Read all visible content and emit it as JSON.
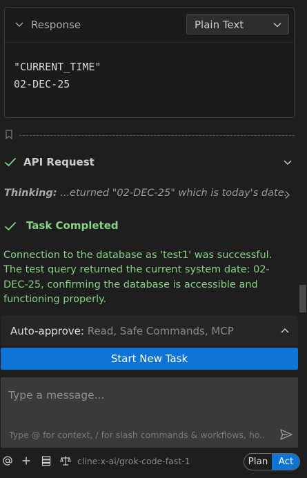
{
  "response": {
    "title": "Response",
    "language": "Plain Text",
    "lines": [
      "\"CURRENT_TIME\"",
      "02-DEC-25"
    ]
  },
  "api_request": {
    "label": "API Request",
    "status": "completed"
  },
  "thinking": {
    "label": "Thinking:",
    "text": " ...eturned \"02-DEC-25\" which is today's date."
  },
  "task": {
    "label": "Task Completed",
    "result": "Connection to the database as 'test1' was successful. The test query returned the current system date: 02-DEC-25, confirming the database is accessible and functioning properly."
  },
  "auto_approve": {
    "label": "Auto-approve:",
    "values": " Read, Safe Commands, MCP"
  },
  "start_button": "Start New Task",
  "input": {
    "placeholder": "Type a message...",
    "hint": "Type @ for context, / for slash commands & workflows, ho..."
  },
  "toolbar": {
    "icons": [
      "at-icon",
      "plus-icon",
      "server-icon",
      "scale-icon"
    ],
    "model": "cline:x-ai/grok-code-fast-1"
  },
  "mode": {
    "plan": "Plan",
    "act": "Act",
    "active": "Act"
  },
  "colors": {
    "accent": "#0e74d6",
    "success": "#89d185",
    "background": "#1e1e1e"
  }
}
